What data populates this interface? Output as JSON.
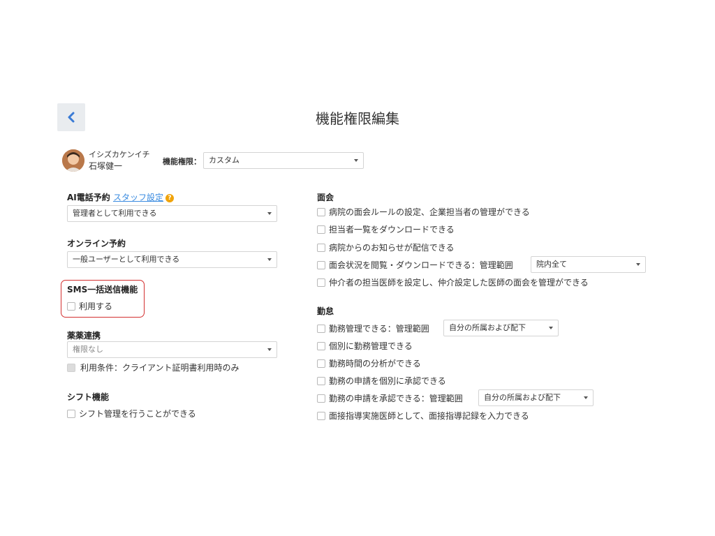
{
  "header": {
    "title": "機能権限編集",
    "back_icon": "chevron-left-icon"
  },
  "user": {
    "kana": "イシズカケンイチ",
    "name": "石塚健一",
    "permission_label": "機能権限：",
    "permission_value": "カスタム"
  },
  "left": {
    "ai": {
      "title": "AI電話予約",
      "link": "スタッフ設定",
      "help": "?",
      "select": "管理者として利用できる"
    },
    "online": {
      "title": "オンライン予約",
      "select": "一般ユーザーとして利用できる"
    },
    "sms": {
      "title": "SMS一括送信機能",
      "checkbox": "利用する"
    },
    "drug": {
      "title": "薬薬連携",
      "select": "権限なし",
      "checkbox": "利用条件：クライアント証明書利用時のみ"
    },
    "shift": {
      "title": "シフト機能",
      "checkbox": "シフト管理を行うことができる"
    }
  },
  "right": {
    "visit": {
      "title": "面会",
      "items": [
        "病院の面会ルールの設定、企業担当者の管理ができる",
        "担当者一覧をダウンロードできる",
        "病院からのお知らせが配信できる",
        "面会状況を閲覧・ダウンロードできる：管理範囲",
        "仲介者の担当医師を設定し、仲介設定した医師の面会を管理ができる"
      ],
      "scope_select": "院内全て"
    },
    "attendance": {
      "title": "勤怠",
      "items": [
        "勤務管理できる：管理範囲",
        "個別に勤務管理できる",
        "勤務時間の分析ができる",
        "勤務の申請を個別に承認できる",
        "勤務の申請を承認できる：管理範囲",
        "面接指導実施医師として、面接指導記録を入力できる"
      ],
      "scope_select_1": "自分の所属および配下",
      "scope_select_2": "自分の所属および配下"
    }
  },
  "colors": {
    "accent": "#3a7bd5",
    "highlight_border": "#d32f2f",
    "help_badge": "#f0a30a"
  }
}
